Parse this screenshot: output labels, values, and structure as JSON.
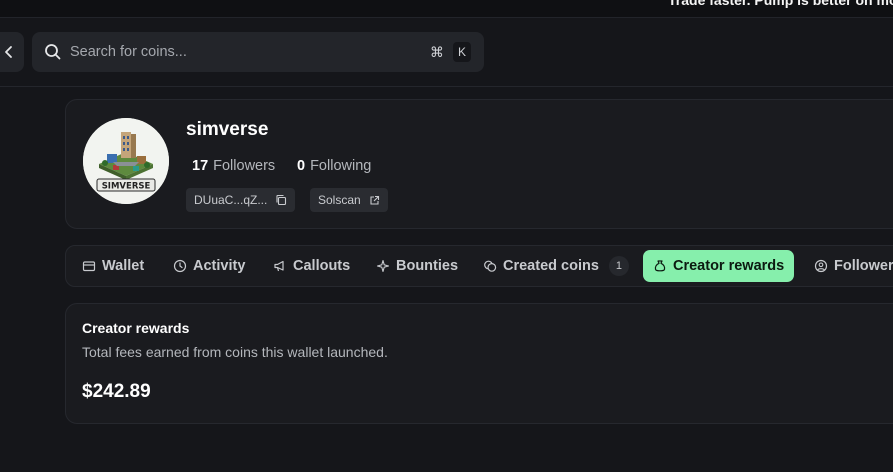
{
  "banner": {
    "text": "Trade faster. Pump is better on mobile"
  },
  "search": {
    "placeholder": "Search for coins...",
    "shortcut_mod": "⌘",
    "shortcut_key": "K"
  },
  "profile": {
    "username": "simverse",
    "avatar_text": "SIMVERSE",
    "followers_count": "17",
    "followers_label": "Followers",
    "following_count": "0",
    "following_label": "Following",
    "address": "DUuaC...qZ...",
    "solscan_label": "Solscan"
  },
  "tabs": [
    {
      "label": "Wallet",
      "icon": "wallet-icon"
    },
    {
      "label": "Activity",
      "icon": "clock-icon"
    },
    {
      "label": "Callouts",
      "icon": "megaphone-icon"
    },
    {
      "label": "Bounties",
      "icon": "sparkle-icon"
    },
    {
      "label": "Created coins",
      "icon": "coins-icon",
      "count": "1"
    },
    {
      "label": "Creator rewards",
      "icon": "moneybag-icon",
      "active": true
    },
    {
      "label": "Followers",
      "icon": "user-icon"
    }
  ],
  "rewards": {
    "title": "Creator rewards",
    "description": "Total fees earned from coins this wallet launched.",
    "amount": "$242.89"
  },
  "colors": {
    "accent": "#86efac",
    "background": "#15161a",
    "card": "#1a1b1f"
  }
}
